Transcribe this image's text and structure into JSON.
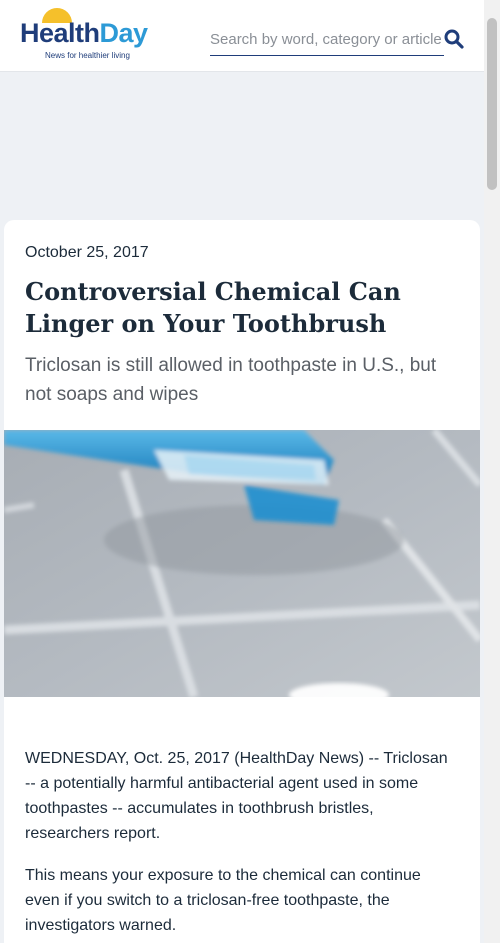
{
  "header": {
    "logo_health": "Health",
    "logo_day": "Day",
    "tagline": "News for healthier living",
    "search_placeholder": "Search by word, category or article",
    "colors": {
      "brand_dark": "#1f3d7a",
      "brand_light": "#2d9ad6",
      "sun": "#f5c02b"
    }
  },
  "article": {
    "date": "October 25, 2017",
    "title": "Controversial Chemical Can Linger on Your Toothbrush",
    "subtitle": "Triclosan is still allowed in toothpaste in U.S., but not soaps and wipes",
    "paragraphs": [
      "WEDNESDAY, Oct. 25, 2017 (HealthDay News) -- Triclosan -- a potentially harmful antibacterial agent used in some toothpastes -- accumulates in toothbrush bristles, researchers report.",
      "This means your exposure to the chemical can continue even if you switch to a triclosan-free toothpaste, the investigators warned."
    ]
  },
  "icons": {
    "search": "search-icon",
    "logo_sun": "sun-icon"
  }
}
